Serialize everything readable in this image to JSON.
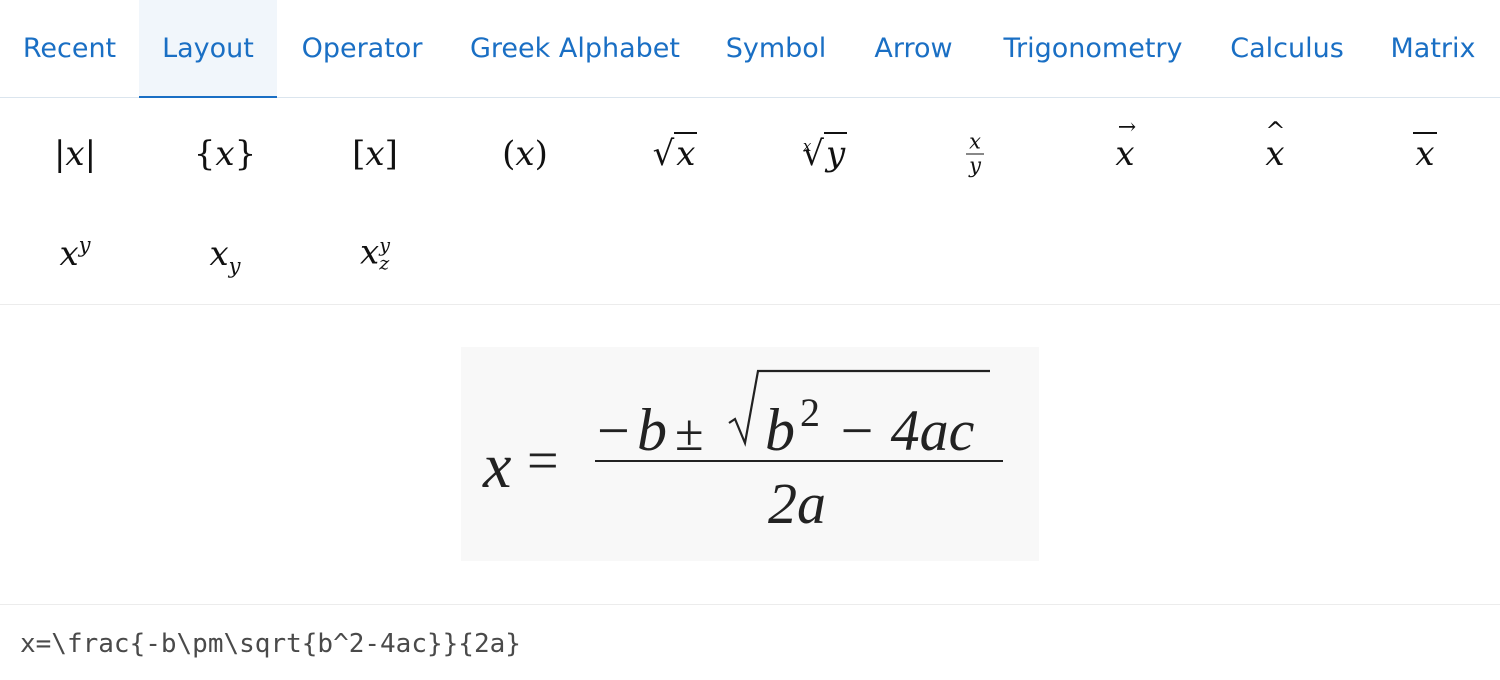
{
  "tabs": [
    {
      "label": "Recent",
      "active": false
    },
    {
      "label": "Layout",
      "active": true
    },
    {
      "label": "Operator",
      "active": false
    },
    {
      "label": "Greek Alphabet",
      "active": false
    },
    {
      "label": "Symbol",
      "active": false
    },
    {
      "label": "Arrow",
      "active": false
    },
    {
      "label": "Trigonometry",
      "active": false
    },
    {
      "label": "Calculus",
      "active": false
    },
    {
      "label": "Matrix",
      "active": false
    }
  ],
  "palette": {
    "items": [
      {
        "name": "absolute-value",
        "x": "x"
      },
      {
        "name": "braces",
        "x": "x"
      },
      {
        "name": "square-brackets",
        "x": "x"
      },
      {
        "name": "parentheses",
        "x": "x"
      },
      {
        "name": "square-root",
        "x": "x"
      },
      {
        "name": "nth-root",
        "x": "x",
        "y": "y"
      },
      {
        "name": "fraction",
        "x": "x",
        "y": "y"
      },
      {
        "name": "vector",
        "x": "x"
      },
      {
        "name": "hat",
        "x": "x"
      },
      {
        "name": "overline",
        "x": "x"
      },
      {
        "name": "superscript",
        "x": "x",
        "y": "y"
      },
      {
        "name": "subscript",
        "x": "x",
        "y": "y"
      },
      {
        "name": "sub-superscript",
        "x": "x",
        "y": "y",
        "z": "z"
      }
    ]
  },
  "preview": {
    "lhs": "x",
    "eq": "=",
    "numerator": {
      "minus": "−",
      "b": "b",
      "pm": "±",
      "radicand_b": "b",
      "exp": "2",
      "rest": "− 4ac"
    },
    "denominator": "2a"
  },
  "latex_input": {
    "value": "x=\\frac{-b\\pm\\sqrt{b^2-4ac}}{2a}"
  }
}
